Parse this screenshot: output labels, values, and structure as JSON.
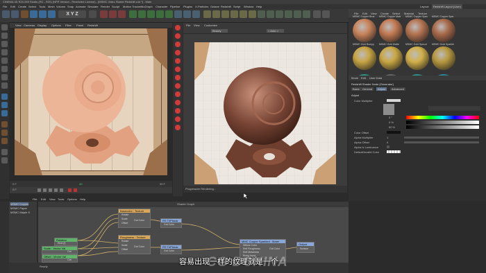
{
  "titlebar": {
    "title": "CINEMA 4D R20.059 Studio (RC - R20) (NFR Version - Restricted License) - [MSMC Video Starter Redshift.c4d *] - Main"
  },
  "menu": [
    "File",
    "Edit",
    "Create",
    "Select",
    "Tools",
    "Mesh",
    "Volume",
    "Snap",
    "Animate",
    "Simulate",
    "Render",
    "Sculpt",
    "Motion Tracker",
    "MoGraph",
    "Character",
    "Pipeline",
    "Plugins",
    "X-Particles",
    "Octane",
    "Redshift",
    "Script",
    "Window",
    "Help"
  ],
  "layout": {
    "label": "Layout:",
    "value": "Redshift Layout (User)"
  },
  "viewport": {
    "menu": [
      "View",
      "Cameras",
      "Display",
      "Options",
      "Filter",
      "Panel",
      "Redshift"
    ],
    "frame_start": "0 F",
    "frame_end": "90 F",
    "frame_mid": "40",
    "frame_current": "0 F"
  },
  "render_view": {
    "menu": [
      "File",
      "View",
      "Customize"
    ],
    "dropdown": "Beauty",
    "aov": "< Auto >",
    "status": "Progressive Rendering..."
  },
  "material_browser": {
    "menu": [
      "File",
      "Edit",
      "View",
      "Create",
      "Select",
      "Material",
      "Texture"
    ],
    "materials": [
      {
        "label": "MSMC Copper Brus",
        "color": "#c9845a"
      },
      {
        "label": "MSMC Copper Matt",
        "color": "#c27a52"
      },
      {
        "label": "MSMC Copper Spec",
        "color": "#b57451"
      },
      {
        "label": "MSMC Copper Spar",
        "color": "#a86a4a"
      },
      {
        "label": "MSMC Gold Bumpy",
        "color": "#c8a544"
      },
      {
        "label": "MSMC Gold Matte",
        "color": "#c9a743"
      },
      {
        "label": "MSMC Gold Specul",
        "color": "#d2b04a"
      },
      {
        "label": "MSMC Gold Sparkle",
        "color": "#b8993f"
      },
      {
        "label": "",
        "color": "#2f9c88"
      },
      {
        "label": "",
        "color": "#6a6a6a"
      },
      {
        "label": "",
        "color": "#2c9c93"
      },
      {
        "label": "",
        "color": "#2c8ca1"
      }
    ]
  },
  "attributes": {
    "menu": [
      "Mode",
      "Edit",
      "User Data"
    ],
    "title": "Redshift Shader Node [Generator]",
    "tabs": [
      "Basic",
      "General",
      "Adjust",
      "Advanced"
    ],
    "section": "Adjust",
    "color_multiplier": "Color Multiplier",
    "rgb_values": [
      "0 °",
      "0 %",
      "60 %"
    ],
    "rows": [
      "Color Offset",
      "Alpha Multiplier",
      "Alpha Offset",
      "Alpha Is Luminance",
      "Default/Invalid Color"
    ],
    "alpha_multiplier": "1",
    "alpha_offset": "0"
  },
  "materials_list": [
    "MSMC Copper",
    "MSMC Paper",
    "MSMC Maple S"
  ],
  "shader_graph": {
    "title": "Shader Graph",
    "menu": [
      "File",
      "Edit",
      "View",
      "Tools",
      "Options",
      "Help"
    ],
    "nodes": [
      {
        "title": "Basecolor : Texture",
        "ports": [
          "Rotate",
          "Scale",
          "Offset"
        ],
        "out": "Out Color"
      },
      {
        "title": "RS TriPlanar",
        "ports": [],
        "out": "Out Color"
      },
      {
        "title": "Roughness : Texture",
        "ports": [
          "Rotate",
          "Scale",
          "Offset"
        ],
        "out": "Out Color"
      },
      {
        "title": "RS TriPlanar",
        "ports": [],
        "out": "Out Color"
      },
      {
        "title": "MMC Copper Sparkled : Mater",
        "ports": [
          "Diffuse Color",
          "Refl Roughness",
          "Refl Metalness",
          "Bump Input"
        ],
        "out": "Out Color"
      },
      {
        "title": "Output",
        "ports": [
          "Surface"
        ],
        "out": ""
      },
      {
        "title": "Rotation",
        "ports": [
          "Real (f)"
        ],
        "out": ""
      },
      {
        "title": "Scale : Vector Val",
        "ports": [
          "Out"
        ],
        "out": ""
      },
      {
        "title": "Offset : Vector Val",
        "ports": [
          "Out"
        ],
        "out": ""
      }
    ]
  },
  "bottom": {
    "label": "Ready"
  },
  "subtitle": "容易出现一样的纹理就是一个",
  "watermark": "CG DCHINA"
}
